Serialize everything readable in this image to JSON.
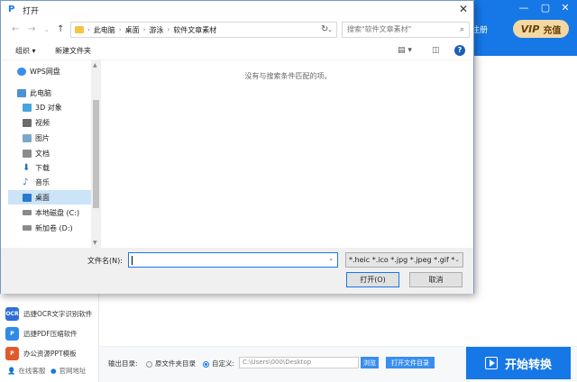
{
  "app": {
    "login_label": "/注册",
    "vip_tag": "VIP",
    "vip_label": "充值",
    "window_controls": [
      "minimize",
      "maximize",
      "close"
    ],
    "sidebar_tools": [
      {
        "label": "迅捷OCR文字识别软件",
        "icon": "ocr-icon",
        "color": "#2f6fd6"
      },
      {
        "label": "迅捷PDF压缩软件",
        "icon": "pdf-compress-icon",
        "color": "#2f8be6"
      },
      {
        "label": "办公资源PPT模板",
        "icon": "ppt-template-icon",
        "color": "#e05a2b"
      }
    ],
    "sidebar_footer": [
      {
        "label": "在线客服",
        "icon": "customer-service-icon"
      },
      {
        "label": "官网地址",
        "icon": "website-icon"
      }
    ],
    "output": {
      "label": "输出目录:",
      "option_source": "原文件夹目录",
      "option_custom": "自定义:",
      "path": "C:\\Users\\000\\Desktop",
      "browse_label": "浏览",
      "open_folder_label": "打开文件目录"
    },
    "start_label": "开始转换",
    "accent": "#1677e6"
  },
  "dialog": {
    "title": "打开",
    "breadcrumb": [
      "此电脑",
      "桌面",
      "游泳",
      "软件文章素材"
    ],
    "search_placeholder": "搜索\"软件文章素材\"",
    "organize_label": "组织 ▾",
    "new_folder_label": "新建文件夹",
    "tree": [
      {
        "label": "WPS网盘",
        "icon": "cloud-icon",
        "indent": 0,
        "color": "#3a8ef0"
      },
      {
        "label": "此电脑",
        "icon": "computer-icon",
        "indent": 0,
        "color": "#4a90d9"
      },
      {
        "label": "3D 对象",
        "icon": "3d-objects-icon",
        "indent": 1,
        "color": "#4aa3df"
      },
      {
        "label": "视频",
        "icon": "video-icon",
        "indent": 1,
        "color": "#6b6b6b"
      },
      {
        "label": "图片",
        "icon": "pictures-icon",
        "indent": 1,
        "color": "#7aa7c7"
      },
      {
        "label": "文档",
        "icon": "documents-icon",
        "indent": 1,
        "color": "#8c8c8c"
      },
      {
        "label": "下载",
        "icon": "download-icon",
        "indent": 1,
        "color": "#2b6cc4"
      },
      {
        "label": "音乐",
        "icon": "music-icon",
        "indent": 1,
        "color": "#2b6cc4"
      },
      {
        "label": "桌面",
        "icon": "desktop-icon",
        "indent": 1,
        "color": "#2b78d0",
        "selected": true
      },
      {
        "label": "本地磁盘 (C:)",
        "icon": "disk-icon",
        "indent": 1,
        "color": "#8a8a8a"
      },
      {
        "label": "新加卷 (D:)",
        "icon": "disk-icon",
        "indent": 1,
        "color": "#8a8a8a"
      }
    ],
    "empty_message": "没有与搜索条件匹配的项。",
    "filename_label": "文件名(N):",
    "filename_value": "",
    "filter_value": "*.heic *.ico *.jpg *.jpeg *.gif *",
    "open_label": "打开(O)",
    "cancel_label": "取消"
  }
}
